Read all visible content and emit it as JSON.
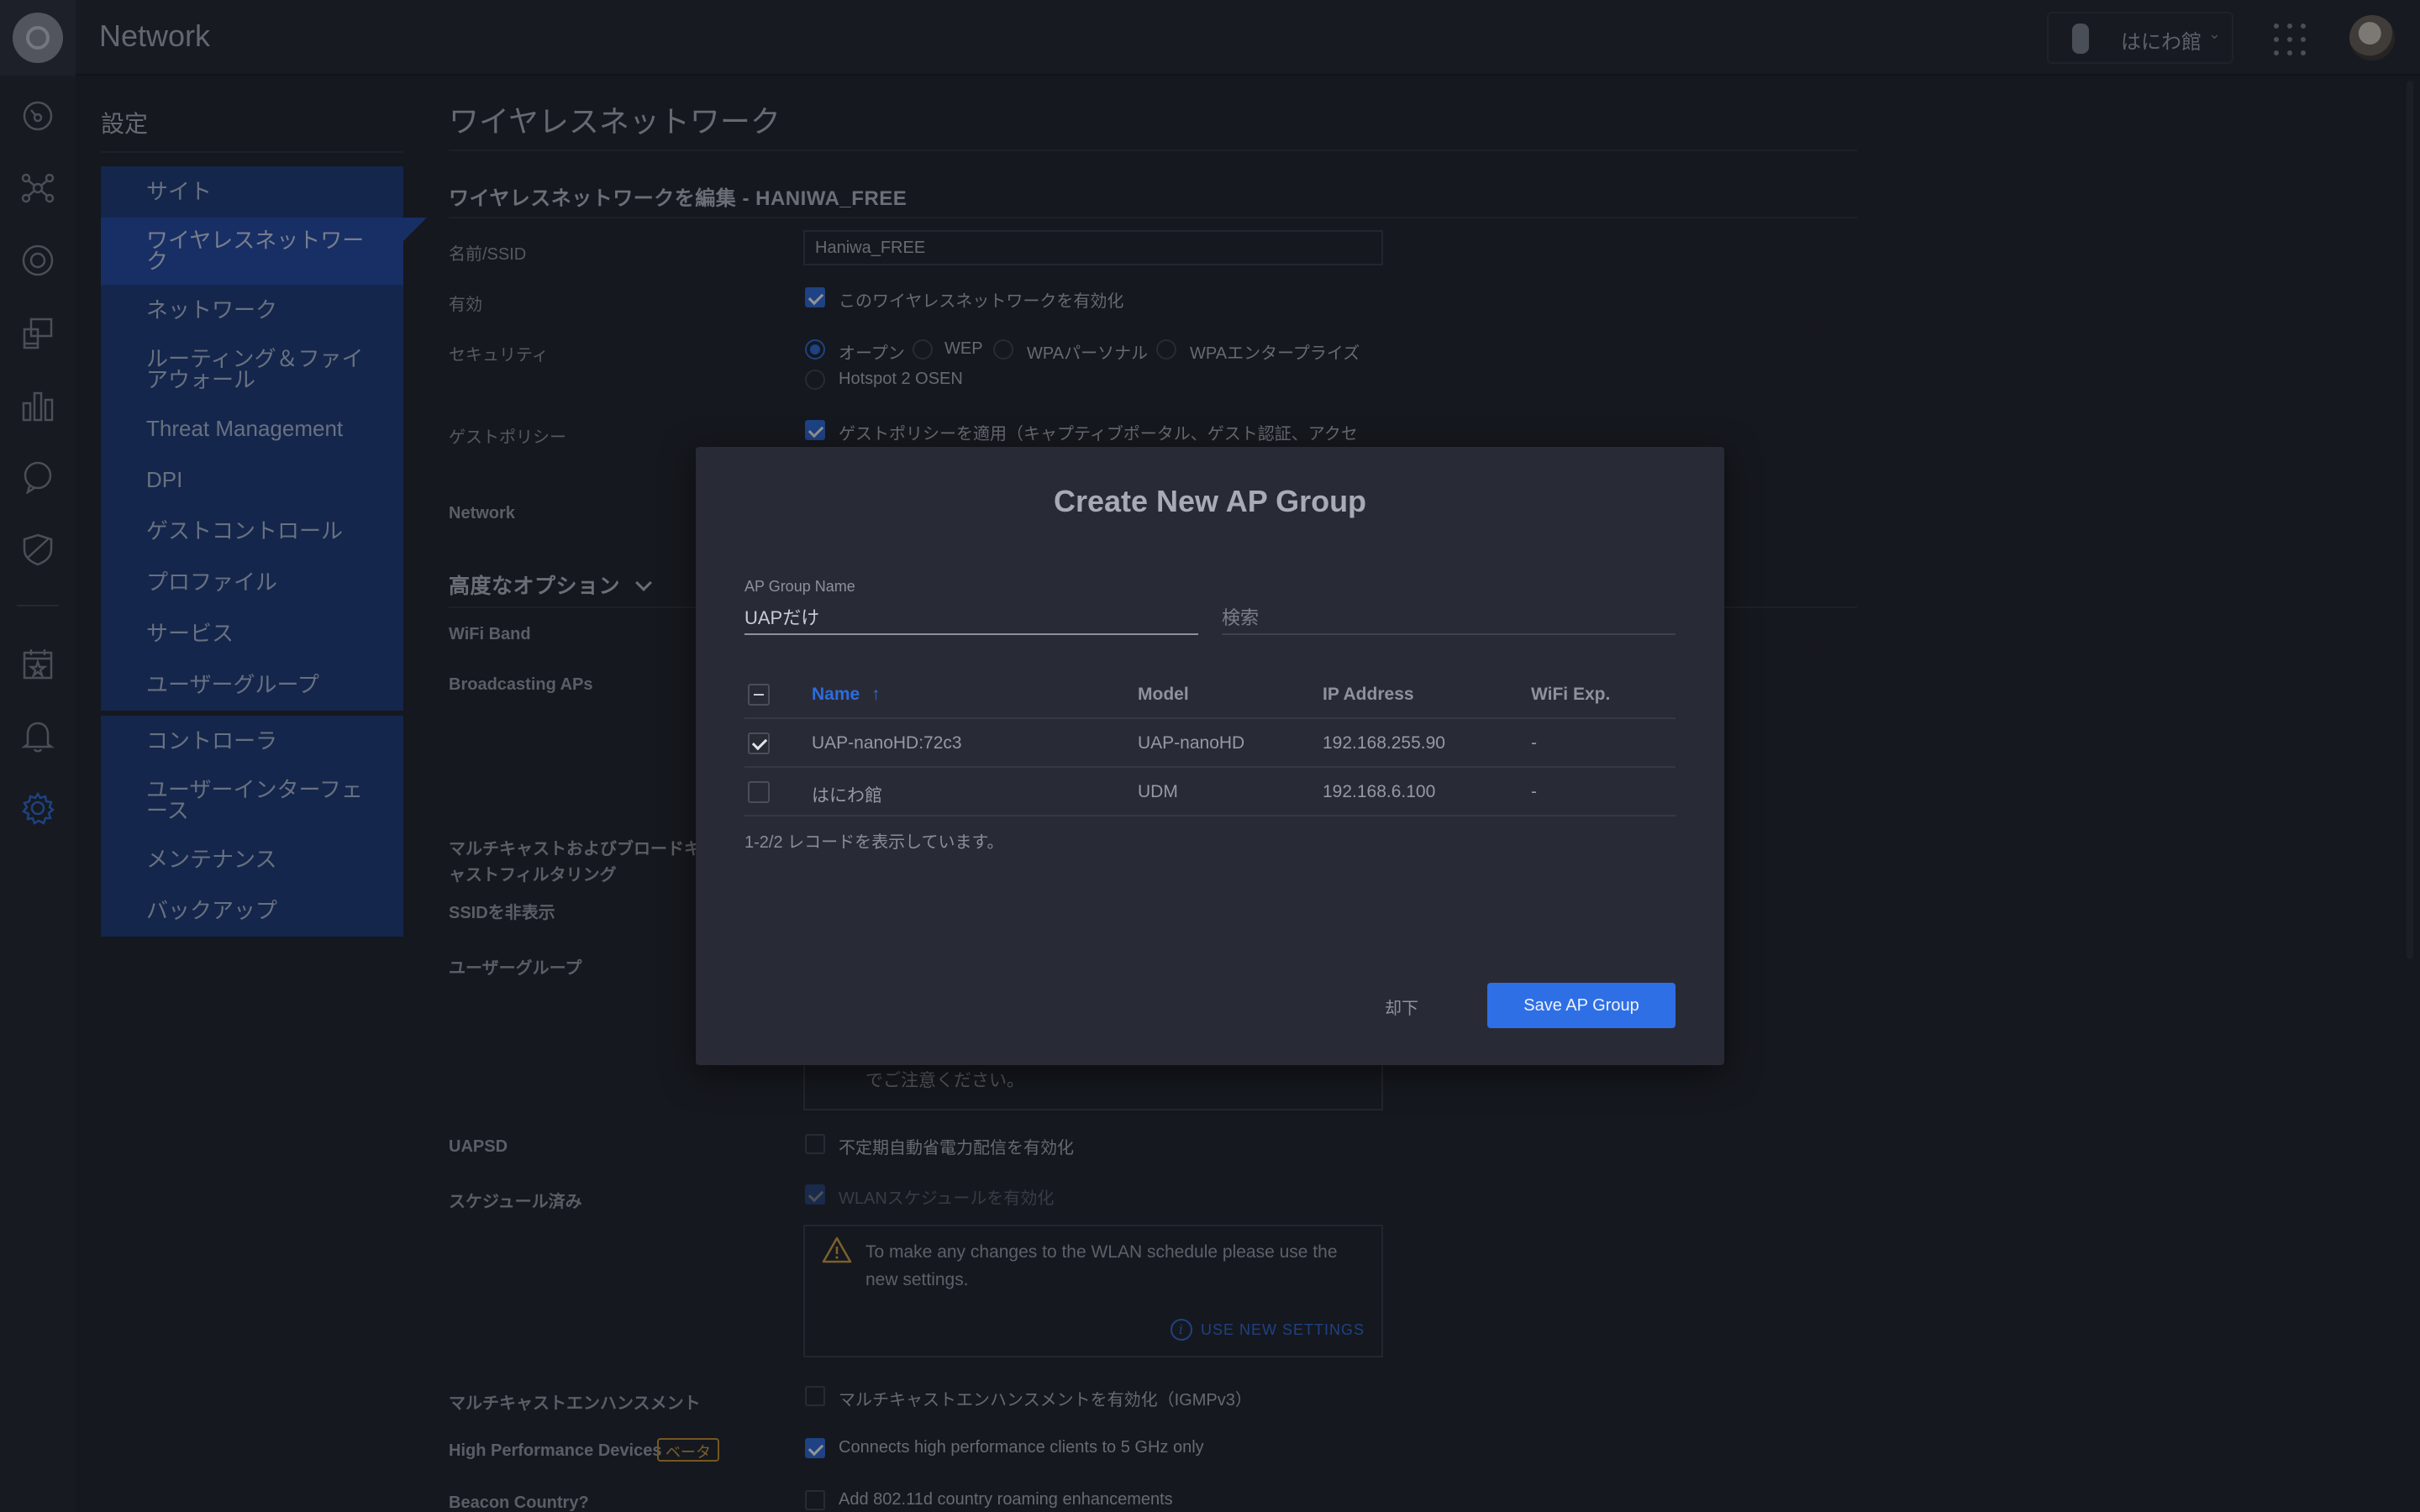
{
  "header": {
    "app_title": "Network",
    "site_name": "はにわ館",
    "site_chevron": "⌄"
  },
  "rail": {
    "icons": [
      "dashboard-icon",
      "topology-icon",
      "devices-icon",
      "clients-icon",
      "statistics-icon",
      "insights-icon",
      "threat-icon",
      "events-icon",
      "alerts-icon",
      "settings-icon"
    ]
  },
  "settings": {
    "title": "設定",
    "nav": [
      "サイト",
      "ワイヤレスネットワーク",
      "ネットワーク",
      "ルーティング＆ファイアウォール",
      "Threat Management",
      "DPI",
      "ゲストコントロール",
      "プロファイル",
      "サービス",
      "ユーザーグループ",
      "コントローラ",
      "ユーザーインターフェース",
      "メンテナンス",
      "バックアップ"
    ]
  },
  "page": {
    "title": "ワイヤレスネットワーク",
    "section_title": "ワイヤレスネットワークを編集 - HANIWA_FREE",
    "labels": {
      "ssid": "名前/SSID",
      "enabled": "有効",
      "security": "セキュリティ",
      "guest_policy": "ゲストポリシー",
      "network": "Network",
      "advanced": "高度なオプション",
      "wifi_band": "WiFi Band",
      "broadcasting_aps": "Broadcasting APs",
      "multicast_filter": "マルチキャストおよびブロードキャストフィルタリング",
      "hide_ssid": "SSIDを非表示",
      "user_group": "ユーザーグループ",
      "uapsd": "UAPSD",
      "scheduled": "スケジュール済み",
      "multicast_enh": "マルチキャストエンハンスメント",
      "high_perf": "High Performance Devices",
      "beacon_country": "Beacon Country?"
    },
    "ssid_value": "Haniwa_FREE",
    "enable_wlan": "このワイヤレスネットワークを有効化",
    "security_options": [
      "オープン",
      "WEP",
      "WPAパーソナル",
      "WPAエンタープライズ",
      "Hotspot 2 OSEN"
    ],
    "guest_policy_text": "ゲストポリシーを適用（キャプティブポータル、ゲスト認証、アクセ",
    "notice_tail": "でご注意ください。",
    "uapsd_text": "不定期自動省電力配信を有効化",
    "schedule_text": "WLANスケジュールを有効化",
    "warning_text": "To make any changes to the WLAN schedule please use the new settings.",
    "use_new_settings": "USE NEW SETTINGS",
    "multicast_enh_text": "マルチキャストエンハンスメントを有効化（IGMPv3）",
    "beta": "ベータ",
    "high_perf_text": "Connects high performance clients to 5 GHz only",
    "beacon_text": "Add 802.11d country roaming enhancements"
  },
  "modal": {
    "title": "Create New AP Group",
    "group_name_label": "AP Group Name",
    "group_name_value": "UAPだけ",
    "search_placeholder": "検索",
    "columns": [
      "Name",
      "Model",
      "IP Address",
      "WiFi Exp."
    ],
    "sort_arrow": "↑",
    "rows": [
      {
        "checked": true,
        "name": "UAP-nanoHD:72c3",
        "model": "UAP-nanoHD",
        "ip": "192.168.255.90",
        "wifi_exp": "-"
      },
      {
        "checked": false,
        "name": "はにわ館",
        "model": "UDM",
        "ip": "192.168.6.100",
        "wifi_exp": "-"
      }
    ],
    "records_text": "1-2/2 レコードを表示しています。",
    "dismiss_label": "却下",
    "save_label": "Save AP Group"
  },
  "colors": {
    "accent": "#2d6cdf",
    "nav_bg": "#1b3a78",
    "nav_active": "#1f4aa8",
    "warning": "#d6a243"
  }
}
